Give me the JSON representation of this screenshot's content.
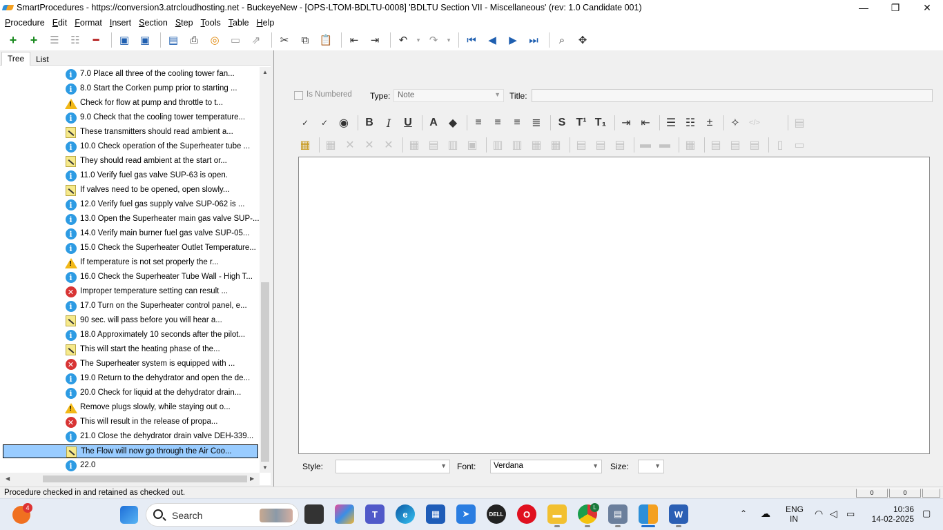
{
  "window": {
    "title": "SmartProcedures - https://conversion3.atrcloudhosting.net - BuckeyeNew - [OPS-LTOM-BDLTU-0008] 'BDLTU Section VII - Miscellaneous' (rev: 1.0 Candidate 001)",
    "minimize": "—",
    "maximize": "❐",
    "close": "✕"
  },
  "menu": [
    "Procedure",
    "Edit",
    "Format",
    "Insert",
    "Section",
    "Step",
    "Tools",
    "Table",
    "Help"
  ],
  "tabs": {
    "tree": "Tree",
    "list": "List"
  },
  "tree_items": [
    {
      "icon": "info",
      "label": "7.0 Place all three of the cooling tower fan..."
    },
    {
      "icon": "info",
      "label": "8.0 Start the Corken pump prior to starting ..."
    },
    {
      "icon": "warning",
      "label": "Check for flow at pump and throttle to t..."
    },
    {
      "icon": "info",
      "label": "9.0 Check that the cooling tower temperature..."
    },
    {
      "icon": "note",
      "label": "These transmitters should read ambient a..."
    },
    {
      "icon": "info",
      "label": "10.0 Check operation of the Superheater tube ..."
    },
    {
      "icon": "note",
      "label": "They should read ambient at the start or..."
    },
    {
      "icon": "info",
      "label": "11.0 Verify fuel gas valve SUP-63 is open."
    },
    {
      "icon": "note",
      "label": "If valves need to be opened, open slowly..."
    },
    {
      "icon": "info",
      "label": "12.0 Verify fuel gas supply valve SUP-062 is ..."
    },
    {
      "icon": "info",
      "label": "13.0 Open the Superheater main gas valve SUP-..."
    },
    {
      "icon": "info",
      "label": "14.0 Verify main burner fuel gas valve SUP-05..."
    },
    {
      "icon": "info",
      "label": "15.0 Check the Superheater Outlet Temperature..."
    },
    {
      "icon": "warning",
      "label": "If temperature is not set properly the r..."
    },
    {
      "icon": "info",
      "label": "16.0 Check the Superheater Tube Wall - High T..."
    },
    {
      "icon": "error",
      "label": "Improper temperature setting can result ..."
    },
    {
      "icon": "info",
      "label": "17.0 Turn on the Superheater control panel, e..."
    },
    {
      "icon": "note",
      "label": "90 sec. will pass before you will hear a..."
    },
    {
      "icon": "info",
      "label": "18.0 Approximately 10 seconds after the pilot..."
    },
    {
      "icon": "note",
      "label": "This will start the heating phase of the..."
    },
    {
      "icon": "error",
      "label": "The Superheater system is equipped with ..."
    },
    {
      "icon": "info",
      "label": "19.0 Return to the dehydrator and open the de..."
    },
    {
      "icon": "info",
      "label": "20.0 Check for liquid at the dehydrator drain..."
    },
    {
      "icon": "warning",
      "label": "Remove plugs slowly, while staying out o..."
    },
    {
      "icon": "error",
      "label": "This will result in the release of propa..."
    },
    {
      "icon": "info",
      "label": "21.0 Close the dehydrator drain valve DEH-339..."
    },
    {
      "icon": "note",
      "label": "The Flow will now go through the Air Coo...",
      "selected": true
    },
    {
      "icon": "info",
      "label": "22.0"
    }
  ],
  "properties": {
    "is_numbered": "Is Numbered",
    "type_label": "Type:",
    "type_value": "Note",
    "title_label": "Title:",
    "title_value": ""
  },
  "style_bar": {
    "style_label": "Style:",
    "style_value": "",
    "font_label": "Font:",
    "font_value": "Verdana",
    "size_label": "Size:",
    "size_value": ""
  },
  "status": {
    "message": "Procedure checked in and retained as checked out.",
    "panel1": "0",
    "panel2": "0"
  },
  "taskbar": {
    "badge_count": "4",
    "search_placeholder": "Search",
    "chrome_badge": "L",
    "lang_top": "ENG",
    "lang_bottom": "IN",
    "time": "10:36",
    "date": "14-02-2025"
  }
}
